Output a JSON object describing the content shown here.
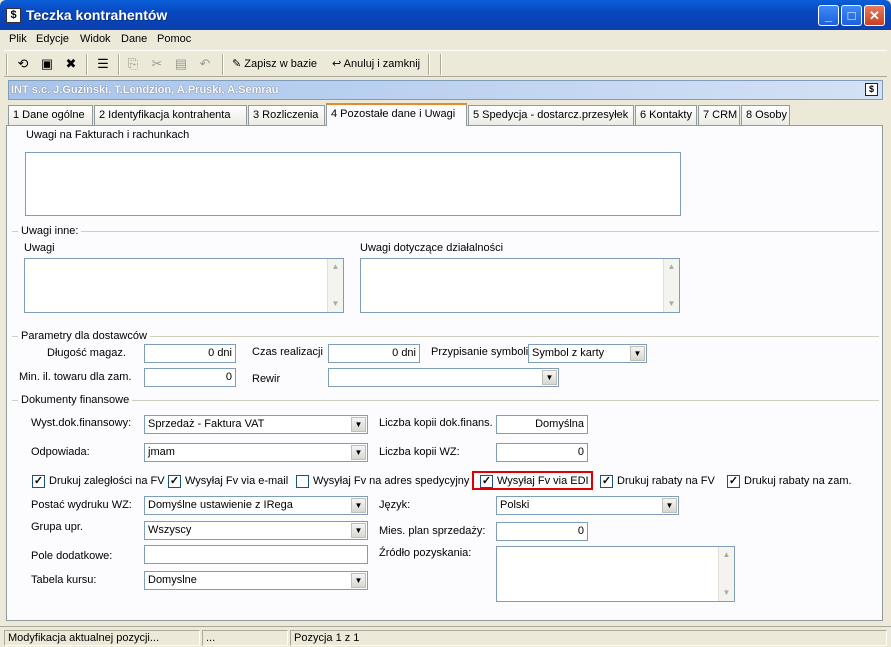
{
  "window": {
    "title": "Teczka kontrahentów",
    "icon": "book-icon"
  },
  "menu": [
    {
      "label": "Plik"
    },
    {
      "label": "Edycje"
    },
    {
      "label": "Widok"
    },
    {
      "label": "Dane"
    },
    {
      "label": "Pomoc"
    }
  ],
  "toolbar": {
    "save_label": "Zapisz w bazie",
    "cancel_label": "Anuluj i zamknij"
  },
  "context": {
    "title": "INT s.c. J.Guziński, T.Lendzion, A.Pruski, A.Semrau"
  },
  "tabs": [
    {
      "label": "1 Dane ogólne"
    },
    {
      "label": "2 Identyfikacja kontrahenta"
    },
    {
      "label": "3 Rozliczenia"
    },
    {
      "label": "4 Pozostałe dane i Uwagi"
    },
    {
      "label": "5 Spedycja - dostarcz.przesyłek"
    },
    {
      "label": "6 Kontakty"
    },
    {
      "label": "7 CRM"
    },
    {
      "label": "8 Osoby"
    }
  ],
  "form": {
    "notes_invoices_label": "Uwagi na Fakturach i rachunkach",
    "notes_other_group": "Uwagi inne:",
    "notes_label": "Uwagi",
    "notes_activity_label": "Uwagi dotyczące działalności",
    "supplier_group": "Parametry dla dostawców",
    "storage_length_label": "Długość magaz.",
    "storage_length_value": "0 dni",
    "realization_label": "Czas realizacji",
    "realization_value": "0 dni",
    "symbol_label": "Przypisanie symboli",
    "symbol_value": "Symbol z karty",
    "min_qty_label": "Min. il. towaru dla zam.",
    "min_qty_value": "0",
    "district_label": "Rewir",
    "district_value": "",
    "fin_docs_group": "Dokumenty finansowe",
    "issue_docs_label": "Wyst.dok.finansowy:",
    "issue_docs_value": "Sprzedaż - Faktura VAT",
    "copies_fin_label": "Liczba kopii dok.finans.",
    "copies_fin_value": "Domyślna",
    "responsible_label": "Odpowiada:",
    "responsible_value": "jmam",
    "copies_wz_label": "Liczba kopii WZ:",
    "copies_wz_value": "0",
    "checkboxes": [
      {
        "label": "Drukuj zaległości na FV",
        "checked": true
      },
      {
        "label": "Wysyłaj Fv via e-mail",
        "checked": true
      },
      {
        "label": "Wysyłaj Fv na adres spedycyjny",
        "checked": false
      },
      {
        "label": "Wysyłaj Fv via EDI",
        "checked": true
      },
      {
        "label": "Drukuj rabaty na FV",
        "checked": true
      },
      {
        "label": "Drukuj rabaty na zam.",
        "checked": true
      }
    ],
    "wz_print_label": "Postać wydruku WZ:",
    "wz_print_value": "Domyślne ustawienie z IRega",
    "language_label": "Język:",
    "language_value": "Polski",
    "group_label": "Grupa upr.",
    "group_value": "Wszyscy",
    "sales_plan_label": "Mies. plan sprzedaży:",
    "sales_plan_value": "0",
    "extra_fields_label": "Pole dodatkowe:",
    "extra_fields_value": "",
    "source_label": "Źródło pozyskania:",
    "rate_table_label": "Tabela kursu:",
    "rate_table_value": "Domyslne"
  },
  "status": {
    "message": "Modyfikacja aktualnej pozycji...",
    "ellipsis": "...",
    "position": "Pozycja 1 z 1"
  },
  "colors": {
    "accent": "#0a5fd8",
    "highlight": "#e00000"
  }
}
